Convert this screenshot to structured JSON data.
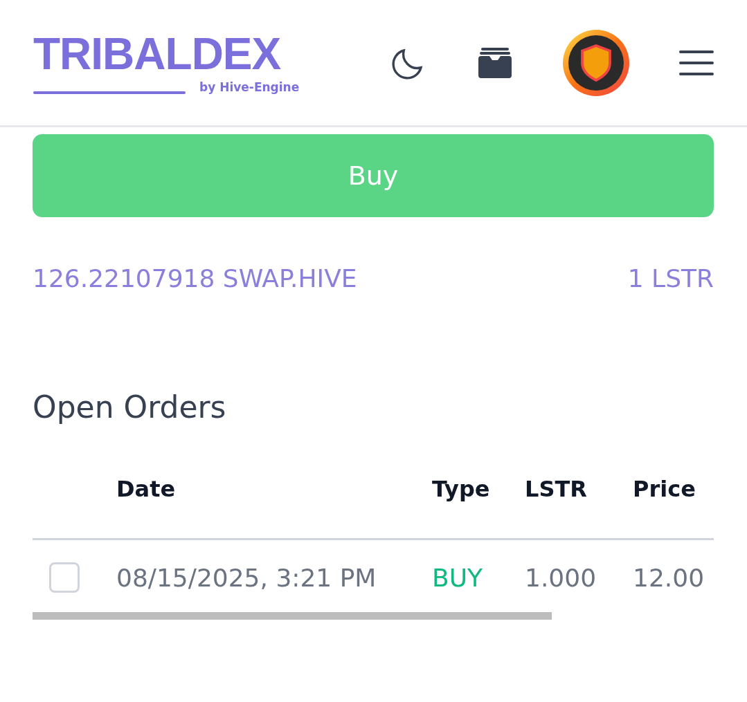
{
  "header": {
    "logo": "TRIBALDEX",
    "logo_subtitle": "by Hive-Engine"
  },
  "buy_button": "Buy",
  "balance": {
    "left": "126.22107918 SWAP.HIVE",
    "right": "1 LSTR"
  },
  "open_orders": {
    "title": "Open Orders",
    "columns": [
      "Date",
      "Type",
      "LSTR",
      "Price"
    ],
    "rows": [
      {
        "checked": false,
        "date": "08/15/2025, 3:21 PM",
        "type": "BUY",
        "amount": "1.000",
        "price": "12.00"
      }
    ]
  }
}
